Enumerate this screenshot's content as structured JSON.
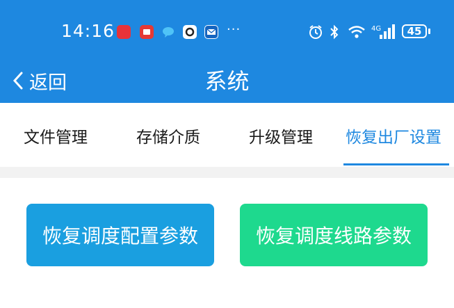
{
  "status_bar": {
    "time": "14:16",
    "more": "···",
    "network": "4G",
    "battery": "45"
  },
  "header": {
    "back_label": "返回",
    "title": "系统"
  },
  "tabs": [
    {
      "label": "文件管理",
      "active": false
    },
    {
      "label": "存储介质",
      "active": false
    },
    {
      "label": "升级管理",
      "active": false
    },
    {
      "label": "恢复出厂设置",
      "active": true
    }
  ],
  "actions": {
    "restore_config": {
      "label": "恢复调度配置参数",
      "color": "#1a9fe0"
    },
    "restore_route": {
      "label": "恢复调度线路参数",
      "color": "#1ed98e"
    }
  },
  "colors": {
    "accent": "#1e88e0",
    "background": "#ffffff",
    "divider": "#f2f2f2"
  }
}
